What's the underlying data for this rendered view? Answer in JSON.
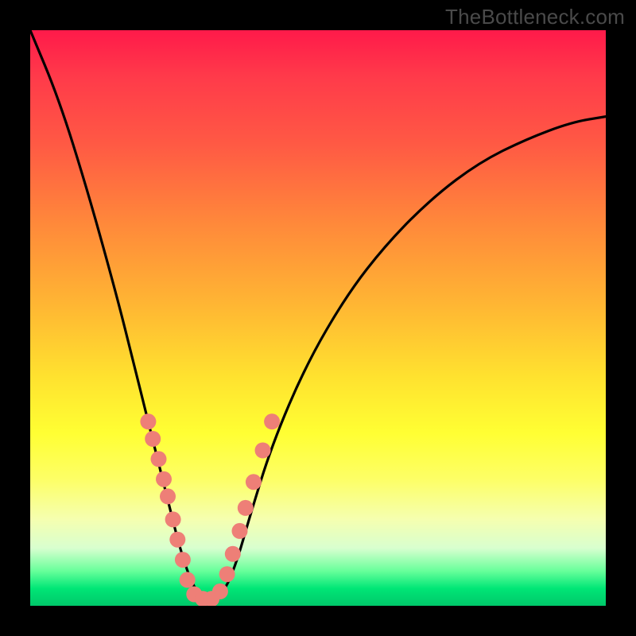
{
  "watermark": "TheBottleneck.com",
  "chart_data": {
    "type": "line",
    "title": "",
    "xlabel": "",
    "ylabel": "",
    "xlim": [
      0,
      100
    ],
    "ylim": [
      0,
      100
    ],
    "grid": false,
    "series": [
      {
        "name": "bottleneck-curve",
        "x": [
          0,
          5,
          10,
          15,
          18,
          20,
          22,
          24,
          26,
          28,
          30,
          32,
          34,
          36,
          38,
          42,
          48,
          55,
          62,
          70,
          78,
          86,
          94,
          100
        ],
        "y": [
          100,
          88,
          72,
          54,
          42,
          34,
          26,
          18,
          10,
          4,
          1,
          1,
          3,
          8,
          15,
          28,
          42,
          54,
          63,
          71,
          77,
          81,
          84,
          85
        ]
      }
    ],
    "markers": {
      "name": "highlighted-points",
      "color": "#ee7f77",
      "points": [
        {
          "x": 20.5,
          "y": 32
        },
        {
          "x": 21.3,
          "y": 29
        },
        {
          "x": 22.3,
          "y": 25.5
        },
        {
          "x": 23.2,
          "y": 22
        },
        {
          "x": 23.9,
          "y": 19
        },
        {
          "x": 24.8,
          "y": 15
        },
        {
          "x": 25.6,
          "y": 11.5
        },
        {
          "x": 26.5,
          "y": 8
        },
        {
          "x": 27.3,
          "y": 4.5
        },
        {
          "x": 28.5,
          "y": 2
        },
        {
          "x": 30.0,
          "y": 1.2
        },
        {
          "x": 31.5,
          "y": 1.2
        },
        {
          "x": 33.0,
          "y": 2.5
        },
        {
          "x": 34.2,
          "y": 5.5
        },
        {
          "x": 35.2,
          "y": 9
        },
        {
          "x": 36.4,
          "y": 13
        },
        {
          "x": 37.4,
          "y": 17
        },
        {
          "x": 38.8,
          "y": 21.5
        },
        {
          "x": 40.4,
          "y": 27
        },
        {
          "x": 42.0,
          "y": 32
        }
      ]
    }
  }
}
